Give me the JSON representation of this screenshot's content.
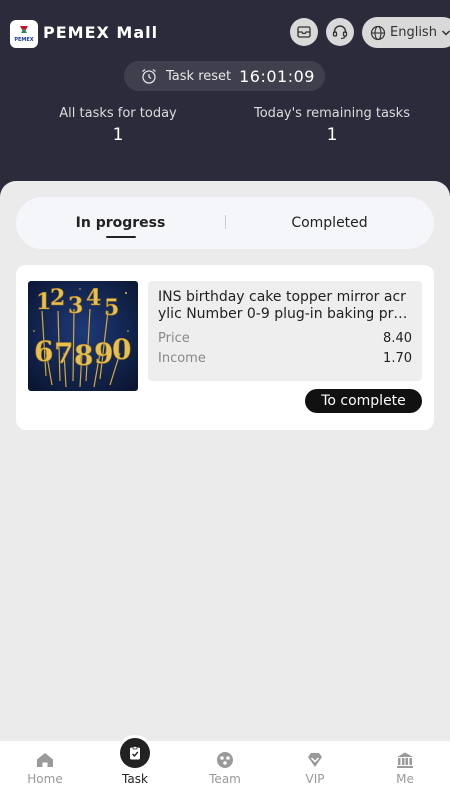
{
  "header": {
    "app_title": "PEMEX Mall",
    "logo_text": "PEMEX",
    "language": "English",
    "task_reset_label": "Task reset",
    "task_reset_time": "16:01:09"
  },
  "stats": {
    "all_tasks_label": "All tasks for today",
    "all_tasks_value": "1",
    "remaining_label": "Today's remaining tasks",
    "remaining_value": "1"
  },
  "tabs": {
    "in_progress": "In progress",
    "completed": "Completed",
    "active": "in_progress"
  },
  "task_card": {
    "product_name": "INS birthday cake topper mirror acrylic Number 0-9 plug-in baking pr…",
    "image_digits": "1234567890",
    "price_label": "Price",
    "price_value": "8.40",
    "income_label": "Income",
    "income_value": "1.70",
    "action_label": "To complete"
  },
  "nav": {
    "items": [
      {
        "label": "Home",
        "icon": "home-icon",
        "active": false
      },
      {
        "label": "Task",
        "icon": "task-icon",
        "active": true
      },
      {
        "label": "Team",
        "icon": "team-icon",
        "active": false
      },
      {
        "label": "VIP",
        "icon": "vip-icon",
        "active": false
      },
      {
        "label": "Me",
        "icon": "bank-icon",
        "active": false
      }
    ]
  },
  "colors": {
    "header_bg": "#2b2b3b",
    "accent": "#111111",
    "page_bg": "#ebebeb"
  }
}
